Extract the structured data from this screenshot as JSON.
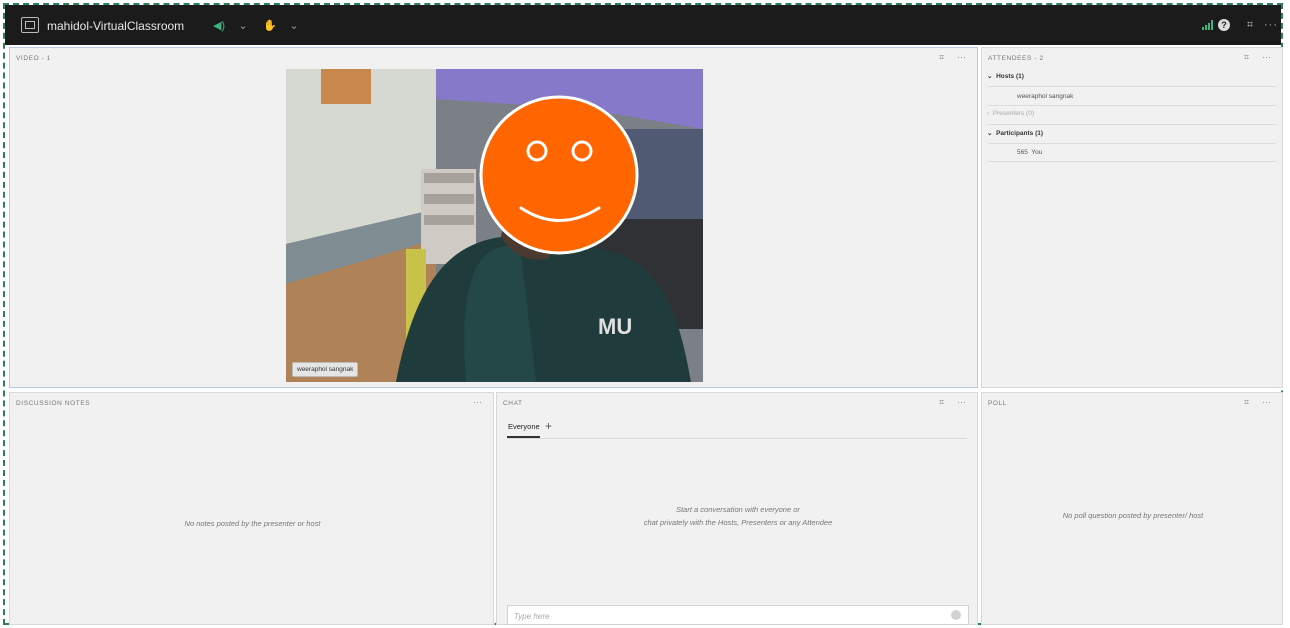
{
  "topbar": {
    "title": "mahidol-VirtualClassroom",
    "icons": {
      "app": "app-frame-icon",
      "speaker": "speaker-icon",
      "speaker_glyph": "◀)",
      "chevron_glyph": "⌄",
      "hand": "raise-hand-icon",
      "hand_glyph": "✋",
      "signal": "signal-bars-icon",
      "help": "help-icon",
      "help_glyph": "?",
      "fullscreen": "fullscreen-icon",
      "fullscreen_glyph": "⌗",
      "more": "more-icon",
      "more_glyph": "···"
    },
    "accent": "#3fb37f"
  },
  "video_pod": {
    "title": "VIDEO - 1",
    "name_tag": "weeraphol sangnak",
    "fullscreen_glyph": "⌗",
    "more_glyph": "···"
  },
  "attendees_pod": {
    "title": "ATTENDEES - 2",
    "fullscreen_glyph": "⌗",
    "more_glyph": "···",
    "chevron_open": "⌄",
    "chevron_closed": "›",
    "hosts_label": "Hosts (1)",
    "host_name": "weeraphol sangnak",
    "presenters_label": "Presenters (0)",
    "participants_label": "Participants (1)",
    "participant_name": "565",
    "participant_you": "You"
  },
  "notes_pod": {
    "title": "DISCUSSION NOTES",
    "more_glyph": "···",
    "empty_text": "No notes posted by the presenter or host"
  },
  "chat_pod": {
    "title": "CHAT",
    "fullscreen_glyph": "⌗",
    "more_glyph": "···",
    "tab_everyone": "Everyone",
    "add_glyph": "+",
    "empty_line1": "Start a conversation with everyone or",
    "empty_line2": "chat privately with the Hosts, Presenters or any Attendee",
    "input_placeholder": "Type here"
  },
  "poll_pod": {
    "title": "POLL",
    "fullscreen_glyph": "⌗",
    "more_glyph": "···",
    "empty_text": "No poll question posted by presenter/ host"
  },
  "avatar_colors": {
    "face": "#ff6600",
    "outline": "#ffffff"
  }
}
